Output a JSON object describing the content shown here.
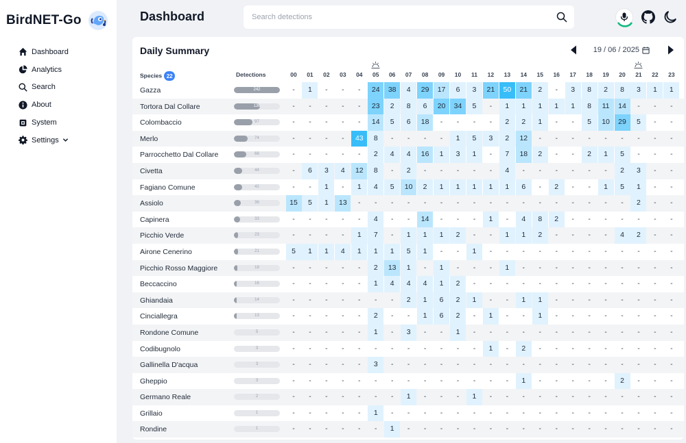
{
  "app": {
    "name": "BirdNET-Go"
  },
  "sidebar": {
    "items": [
      {
        "label": "Dashboard",
        "icon": "home-icon"
      },
      {
        "label": "Analytics",
        "icon": "pie-chart-icon"
      },
      {
        "label": "Search",
        "icon": "search-icon"
      },
      {
        "label": "About",
        "icon": "info-icon"
      },
      {
        "label": "System",
        "icon": "cpu-icon"
      },
      {
        "label": "Settings",
        "icon": "gear-icon"
      }
    ]
  },
  "header": {
    "title": "Dashboard",
    "search_placeholder": "Search detections"
  },
  "summary": {
    "title": "Daily Summary",
    "date": "19 / 06 / 2025",
    "species_label": "Species",
    "species_count": "22",
    "detections_label": "Detections",
    "hours": [
      "00",
      "01",
      "02",
      "03",
      "04",
      "05",
      "06",
      "07",
      "08",
      "09",
      "10",
      "11",
      "12",
      "13",
      "14",
      "15",
      "16",
      "17",
      "18",
      "19",
      "20",
      "21",
      "22",
      "23"
    ],
    "sunrise_hour": "05",
    "sunset_hour": "21",
    "max_detections": 242,
    "rows": [
      {
        "name": "Gazza",
        "total": 242,
        "hours": [
          0,
          1,
          0,
          0,
          0,
          24,
          38,
          4,
          29,
          17,
          6,
          3,
          21,
          50,
          21,
          2,
          0,
          3,
          8,
          2,
          8,
          3,
          1,
          1
        ]
      },
      {
        "name": "Tortora Dal Collare",
        "total": 136,
        "hours": [
          0,
          0,
          0,
          0,
          0,
          23,
          2,
          8,
          6,
          20,
          34,
          5,
          0,
          1,
          1,
          1,
          1,
          1,
          8,
          11,
          14,
          0,
          0,
          0
        ]
      },
      {
        "name": "Colombaccio",
        "total": 97,
        "hours": [
          0,
          0,
          0,
          0,
          0,
          14,
          5,
          6,
          18,
          0,
          0,
          0,
          0,
          2,
          2,
          1,
          0,
          0,
          5,
          10,
          29,
          5,
          0,
          0
        ]
      },
      {
        "name": "Merlo",
        "total": 74,
        "hours": [
          0,
          0,
          0,
          0,
          43,
          8,
          0,
          0,
          0,
          0,
          1,
          5,
          3,
          2,
          12,
          0,
          0,
          0,
          0,
          0,
          0,
          0,
          0,
          0
        ]
      },
      {
        "name": "Parrocchetto Dal Collare",
        "total": 66,
        "hours": [
          0,
          0,
          0,
          0,
          0,
          2,
          4,
          4,
          16,
          1,
          3,
          1,
          0,
          7,
          18,
          2,
          0,
          0,
          2,
          1,
          5,
          0,
          0,
          0
        ]
      },
      {
        "name": "Civetta",
        "total": 44,
        "hours": [
          0,
          6,
          3,
          4,
          12,
          8,
          0,
          2,
          0,
          0,
          0,
          0,
          0,
          4,
          0,
          0,
          0,
          0,
          0,
          0,
          2,
          3,
          0,
          0
        ]
      },
      {
        "name": "Fagiano Comune",
        "total": 42,
        "hours": [
          0,
          0,
          1,
          0,
          1,
          4,
          5,
          10,
          2,
          1,
          1,
          1,
          1,
          1,
          6,
          0,
          2,
          0,
          0,
          1,
          5,
          1,
          0,
          0
        ]
      },
      {
        "name": "Assiolo",
        "total": 36,
        "hours": [
          15,
          5,
          1,
          13,
          0,
          0,
          0,
          0,
          0,
          0,
          0,
          0,
          0,
          0,
          0,
          0,
          0,
          0,
          0,
          0,
          0,
          2,
          0,
          0
        ]
      },
      {
        "name": "Capinera",
        "total": 33,
        "hours": [
          0,
          0,
          0,
          0,
          0,
          4,
          0,
          0,
          14,
          0,
          0,
          0,
          1,
          0,
          4,
          8,
          2,
          0,
          0,
          0,
          0,
          0,
          0,
          0
        ]
      },
      {
        "name": "Picchio Verde",
        "total": 23,
        "hours": [
          0,
          0,
          0,
          0,
          1,
          7,
          0,
          1,
          1,
          1,
          2,
          0,
          0,
          1,
          1,
          2,
          0,
          0,
          0,
          0,
          4,
          2,
          0,
          0
        ]
      },
      {
        "name": "Airone Cenerino",
        "total": 21,
        "hours": [
          5,
          1,
          1,
          4,
          1,
          1,
          1,
          5,
          1,
          0,
          0,
          1,
          0,
          0,
          0,
          0,
          0,
          0,
          0,
          0,
          0,
          0,
          0,
          0
        ]
      },
      {
        "name": "Picchio Rosso Maggiore",
        "total": 18,
        "hours": [
          0,
          0,
          0,
          0,
          0,
          2,
          13,
          1,
          0,
          1,
          0,
          0,
          0,
          1,
          0,
          0,
          0,
          0,
          0,
          0,
          0,
          0,
          0,
          0
        ]
      },
      {
        "name": "Beccaccino",
        "total": 16,
        "hours": [
          0,
          0,
          0,
          0,
          0,
          1,
          4,
          4,
          4,
          1,
          2,
          0,
          0,
          0,
          0,
          0,
          0,
          0,
          0,
          0,
          0,
          0,
          0,
          0
        ]
      },
      {
        "name": "Ghiandaia",
        "total": 14,
        "hours": [
          0,
          0,
          0,
          0,
          0,
          0,
          0,
          2,
          1,
          6,
          2,
          1,
          0,
          0,
          1,
          1,
          0,
          0,
          0,
          0,
          0,
          0,
          0,
          0
        ]
      },
      {
        "name": "Cinciallegra",
        "total": 13,
        "hours": [
          0,
          0,
          0,
          0,
          0,
          2,
          0,
          0,
          1,
          6,
          2,
          0,
          1,
          0,
          0,
          1,
          0,
          0,
          0,
          0,
          0,
          0,
          0,
          0
        ]
      },
      {
        "name": "Rondone Comune",
        "total": 5,
        "hours": [
          0,
          0,
          0,
          0,
          0,
          1,
          0,
          3,
          0,
          0,
          1,
          0,
          0,
          0,
          0,
          0,
          0,
          0,
          0,
          0,
          0,
          0,
          0,
          0
        ]
      },
      {
        "name": "Codibugnolo",
        "total": 3,
        "hours": [
          0,
          0,
          0,
          0,
          0,
          0,
          0,
          0,
          0,
          0,
          0,
          0,
          1,
          0,
          2,
          0,
          0,
          0,
          0,
          0,
          0,
          0,
          0,
          0
        ]
      },
      {
        "name": "Gallinella D'acqua",
        "total": 3,
        "hours": [
          0,
          0,
          0,
          0,
          0,
          3,
          0,
          0,
          0,
          0,
          0,
          0,
          0,
          0,
          0,
          0,
          0,
          0,
          0,
          0,
          0,
          0,
          0,
          0
        ]
      },
      {
        "name": "Gheppio",
        "total": 3,
        "hours": [
          0,
          0,
          0,
          0,
          0,
          0,
          0,
          0,
          0,
          0,
          0,
          0,
          0,
          0,
          1,
          0,
          0,
          0,
          0,
          0,
          2,
          0,
          0,
          0
        ]
      },
      {
        "name": "Germano Reale",
        "total": 2,
        "hours": [
          0,
          0,
          0,
          0,
          0,
          0,
          0,
          1,
          0,
          0,
          0,
          1,
          0,
          0,
          0,
          0,
          0,
          0,
          0,
          0,
          0,
          0,
          0,
          0
        ]
      },
      {
        "name": "Grillaio",
        "total": 1,
        "hours": [
          0,
          0,
          0,
          0,
          0,
          1,
          0,
          0,
          0,
          0,
          0,
          0,
          0,
          0,
          0,
          0,
          0,
          0,
          0,
          0,
          0,
          0,
          0,
          0
        ]
      },
      {
        "name": "Rondine",
        "total": 1,
        "hours": [
          0,
          0,
          0,
          0,
          0,
          0,
          1,
          0,
          0,
          0,
          0,
          0,
          0,
          0,
          0,
          0,
          0,
          0,
          0,
          0,
          0,
          0,
          0,
          0
        ]
      }
    ],
    "empty_cell": "-"
  },
  "colors": {
    "accent": "#3b82f6",
    "heat_low": "#e0f2fe",
    "heat_mid": "#bae6fd",
    "heat_high": "#7dd3fc",
    "heat_max": "#38bdf8",
    "bar_fill": "#9aa0aa"
  }
}
